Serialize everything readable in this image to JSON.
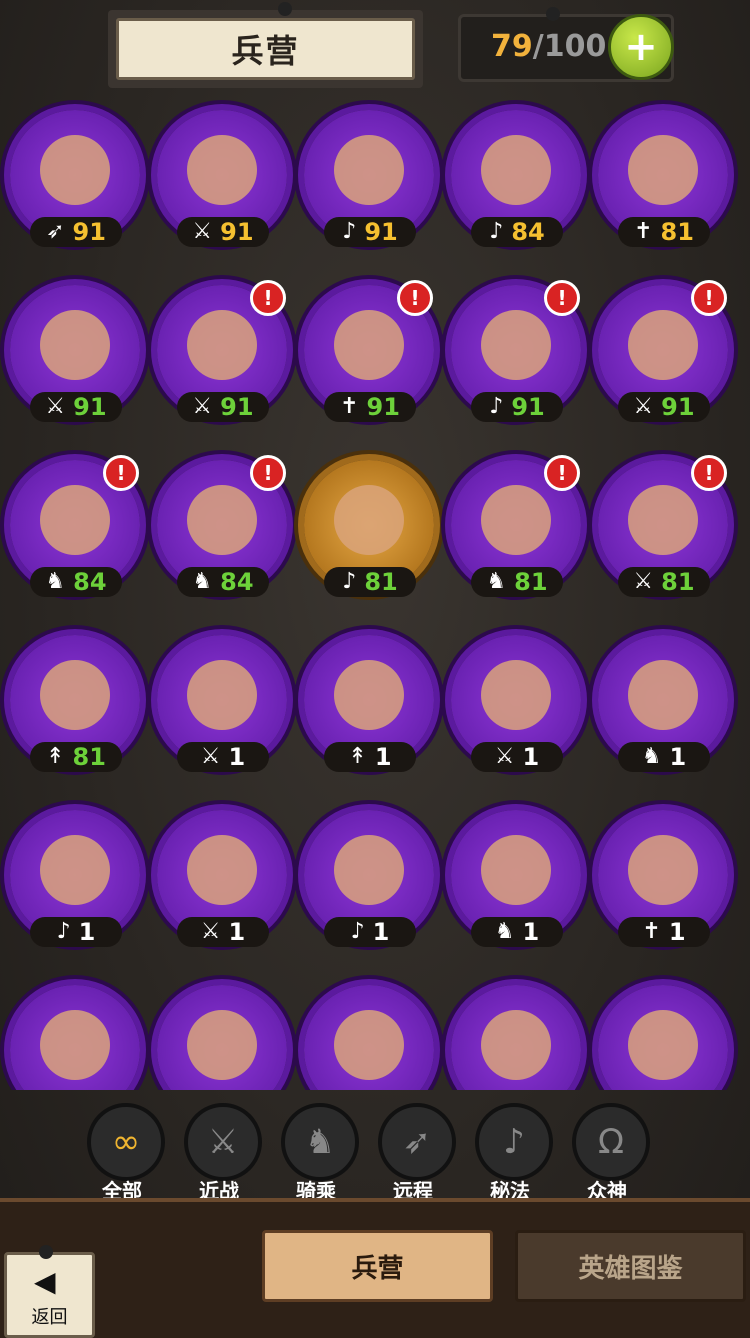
{
  "header": {
    "title": "兵营",
    "capacity_current": "79",
    "capacity_sep": "/",
    "capacity_max": "100",
    "add_icon": "plus-icon",
    "add_symbol": "+"
  },
  "heroes": [
    {
      "cls": "bow",
      "cls_glyph": "➶",
      "level": "91",
      "color": "#f5c030",
      "alert": false,
      "frame": "purple"
    },
    {
      "cls": "sword",
      "cls_glyph": "⚔",
      "level": "91",
      "color": "#f5c030",
      "alert": false,
      "frame": "purple"
    },
    {
      "cls": "magic",
      "cls_glyph": "♪",
      "level": "91",
      "color": "#f5c030",
      "alert": false,
      "frame": "purple"
    },
    {
      "cls": "magic",
      "cls_glyph": "♪",
      "level": "84",
      "color": "#f5c030",
      "alert": false,
      "frame": "purple"
    },
    {
      "cls": "holy",
      "cls_glyph": "✝",
      "level": "81",
      "color": "#f5c030",
      "alert": false,
      "frame": "purple"
    },
    {
      "cls": "sword",
      "cls_glyph": "⚔",
      "level": "91",
      "color": "#6dd13a",
      "alert": false,
      "frame": "purple"
    },
    {
      "cls": "sword",
      "cls_glyph": "⚔",
      "level": "91",
      "color": "#6dd13a",
      "alert": true,
      "frame": "purple"
    },
    {
      "cls": "holy",
      "cls_glyph": "✝",
      "level": "91",
      "color": "#6dd13a",
      "alert": true,
      "frame": "purple"
    },
    {
      "cls": "magic",
      "cls_glyph": "♪",
      "level": "91",
      "color": "#6dd13a",
      "alert": true,
      "frame": "purple"
    },
    {
      "cls": "sword",
      "cls_glyph": "⚔",
      "level": "91",
      "color": "#6dd13a",
      "alert": true,
      "frame": "purple"
    },
    {
      "cls": "mount",
      "cls_glyph": "♞",
      "level": "84",
      "color": "#6dd13a",
      "alert": true,
      "frame": "purple"
    },
    {
      "cls": "mount",
      "cls_glyph": "♞",
      "level": "84",
      "color": "#6dd13a",
      "alert": true,
      "frame": "purple"
    },
    {
      "cls": "magic",
      "cls_glyph": "♪",
      "level": "81",
      "color": "#6dd13a",
      "alert": false,
      "frame": "gold"
    },
    {
      "cls": "mount",
      "cls_glyph": "♞",
      "level": "81",
      "color": "#6dd13a",
      "alert": true,
      "frame": "purple"
    },
    {
      "cls": "sword",
      "cls_glyph": "⚔",
      "level": "81",
      "color": "#6dd13a",
      "alert": true,
      "frame": "purple"
    },
    {
      "cls": "spear",
      "cls_glyph": "↟",
      "level": "81",
      "color": "#6dd13a",
      "alert": false,
      "frame": "purple"
    },
    {
      "cls": "sword",
      "cls_glyph": "⚔",
      "level": "1",
      "color": "#ffffff",
      "alert": false,
      "frame": "purple"
    },
    {
      "cls": "spear",
      "cls_glyph": "↟",
      "level": "1",
      "color": "#ffffff",
      "alert": false,
      "frame": "purple"
    },
    {
      "cls": "sword",
      "cls_glyph": "⚔",
      "level": "1",
      "color": "#ffffff",
      "alert": false,
      "frame": "purple"
    },
    {
      "cls": "mount",
      "cls_glyph": "♞",
      "level": "1",
      "color": "#ffffff",
      "alert": false,
      "frame": "purple"
    },
    {
      "cls": "magic",
      "cls_glyph": "♪",
      "level": "1",
      "color": "#ffffff",
      "alert": false,
      "frame": "purple"
    },
    {
      "cls": "sword",
      "cls_glyph": "⚔",
      "level": "1",
      "color": "#ffffff",
      "alert": false,
      "frame": "purple"
    },
    {
      "cls": "magic",
      "cls_glyph": "♪",
      "level": "1",
      "color": "#ffffff",
      "alert": false,
      "frame": "purple"
    },
    {
      "cls": "mount",
      "cls_glyph": "♞",
      "level": "1",
      "color": "#ffffff",
      "alert": false,
      "frame": "purple"
    },
    {
      "cls": "holy",
      "cls_glyph": "✝",
      "level": "1",
      "color": "#ffffff",
      "alert": false,
      "frame": "purple"
    },
    {
      "cls": "",
      "cls_glyph": "",
      "level": "",
      "color": "#ffffff",
      "alert": false,
      "frame": "purple"
    },
    {
      "cls": "",
      "cls_glyph": "",
      "level": "",
      "color": "#ffffff",
      "alert": false,
      "frame": "purple"
    },
    {
      "cls": "",
      "cls_glyph": "",
      "level": "",
      "color": "#ffffff",
      "alert": false,
      "frame": "purple"
    },
    {
      "cls": "",
      "cls_glyph": "",
      "level": "",
      "color": "#ffffff",
      "alert": false,
      "frame": "purple"
    },
    {
      "cls": "",
      "cls_glyph": "",
      "level": "",
      "color": "#ffffff",
      "alert": false,
      "frame": "purple"
    }
  ],
  "filters": [
    {
      "label": "全部",
      "icon": "infinity-icon",
      "glyph": "∞",
      "active": true
    },
    {
      "label": "近战",
      "icon": "sword-icon",
      "glyph": "⚔",
      "active": false
    },
    {
      "label": "骑乘",
      "icon": "horse-icon",
      "glyph": "♞",
      "active": false
    },
    {
      "label": "远程",
      "icon": "bow-icon",
      "glyph": "➶",
      "active": false
    },
    {
      "label": "秘法",
      "icon": "magic-icon",
      "glyph": "♪",
      "active": false
    },
    {
      "label": "众神",
      "icon": "omega-icon",
      "glyph": "Ω",
      "active": false
    }
  ],
  "bottom": {
    "back_label": "返回",
    "back_arrow": "◀",
    "tab_barracks": "兵营",
    "tab_heroes": "英雄图鉴"
  }
}
